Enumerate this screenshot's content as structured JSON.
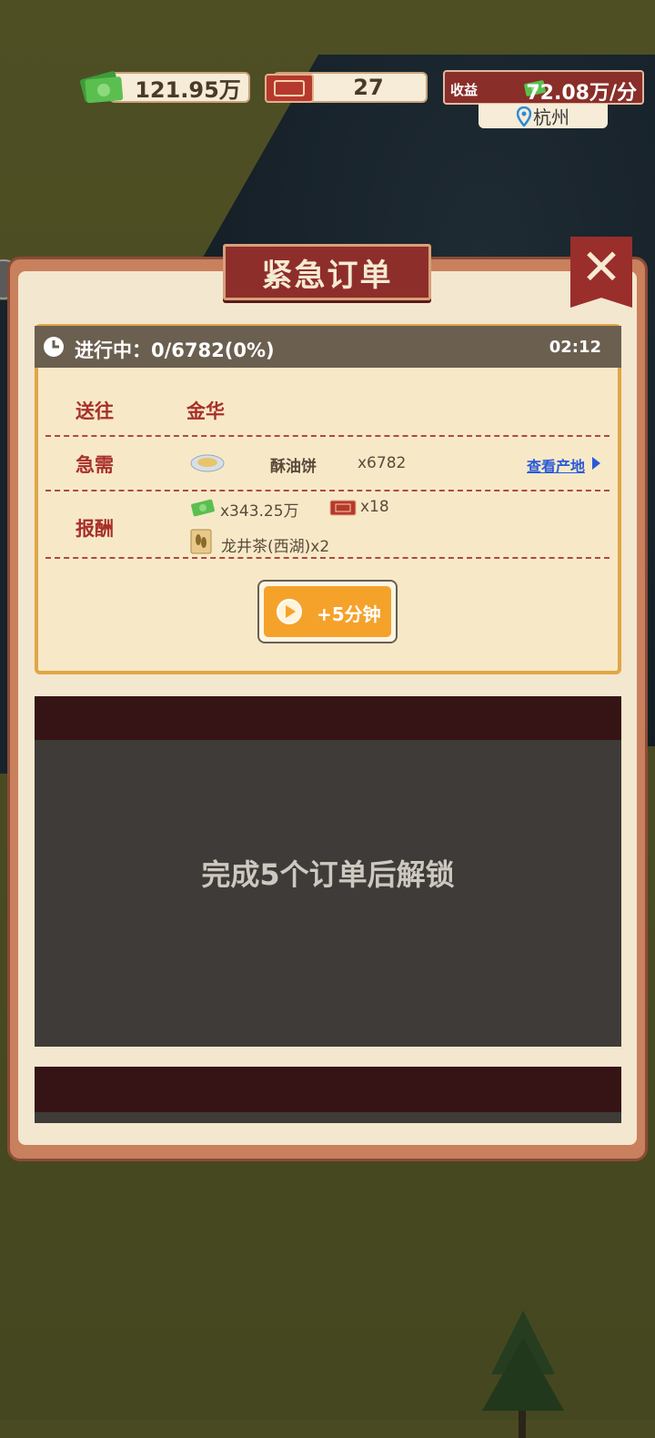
{
  "hud": {
    "money": "121.95万",
    "tickets": "27",
    "income_label": "收益",
    "income_value": "72.08万/分",
    "city": "杭州"
  },
  "dialog": {
    "title": "紧急订单",
    "status": {
      "text": "进行中：0/6782(0%)",
      "timer": "02:12",
      "progress_percent": 0
    },
    "destination": {
      "label": "送往",
      "value": "金华"
    },
    "demand": {
      "label": "急需",
      "item": "酥油饼",
      "quantity": "x6782",
      "origin_link": "查看产地"
    },
    "reward": {
      "label": "报酬",
      "money": "x343.25万",
      "tickets": "x18",
      "item": "龙井茶(西湖)x2"
    },
    "video_button": "+5分钟",
    "locked_text": "完成5个订单后解锁"
  },
  "colors": {
    "accent_red": "#8e2e2b",
    "card_border": "#e0a646",
    "button_orange": "#f5a22b",
    "link_blue": "#2a5ad8"
  },
  "icons": [
    "money-icon",
    "ticket-icon",
    "location-pin-icon",
    "clock-icon",
    "close-icon",
    "plate-icon",
    "tea-icon",
    "play-icon",
    "chevron-right-icon"
  ]
}
